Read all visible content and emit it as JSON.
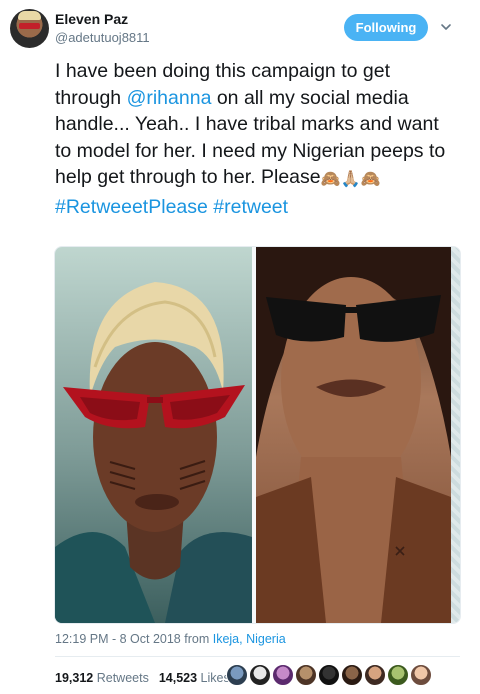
{
  "author": {
    "display_name": "Eleven Paz",
    "handle": "@adetutuoj8811"
  },
  "follow_button": {
    "label": "Following"
  },
  "tweet": {
    "text_1": "I have been doing this campaign to get through ",
    "mention": "@rihanna",
    "text_2": " on all my social media handle... Yeah.. I have tribal marks and want to model for her. I need my Nigerian peeps to help get through to her. Please",
    "emojis": "🙈🙏🏼🙈",
    "hashtag_1": "#RetweeetPlease",
    "hashtag_2": "#retweet"
  },
  "meta": {
    "time": "12:19 PM - 8 Oct 2018",
    "from_word": "from",
    "location": "Ikeja, Nigeria"
  },
  "stats": {
    "retweets_count": "19,312",
    "retweets_label": "Retweets",
    "likes_count": "14,523",
    "likes_label": "Likes"
  },
  "colors": {
    "link": "#1b95e0",
    "follow_bg": "#4ab3f4",
    "muted": "#657786"
  },
  "icons": {
    "caret": "chevron-down-icon"
  }
}
